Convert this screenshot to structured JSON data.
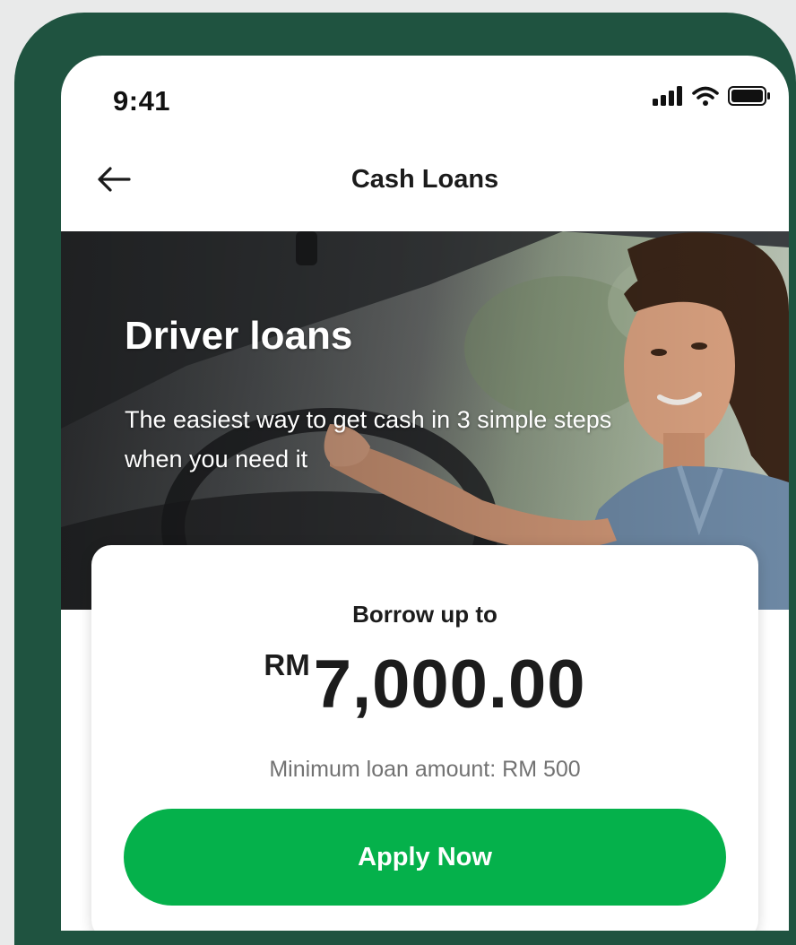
{
  "status_bar": {
    "time": "9:41",
    "icons": [
      "cellular-signal-icon",
      "wifi-icon",
      "battery-icon"
    ]
  },
  "nav": {
    "back_icon": "arrow-left-icon",
    "title": "Cash Loans"
  },
  "hero": {
    "title": "Driver loans",
    "subtitle": "The easiest way to get cash in 3 simple steps when you need it"
  },
  "loan_card": {
    "borrow_label": "Borrow up to",
    "currency": "RM",
    "amount": "7,000.00",
    "minimum_text": "Minimum loan amount: RM 500",
    "apply_label": "Apply Now"
  },
  "colors": {
    "frame": "#1f5340",
    "primary_button": "#05b14b",
    "text_primary": "#1c1c1c",
    "text_secondary": "#727272"
  }
}
